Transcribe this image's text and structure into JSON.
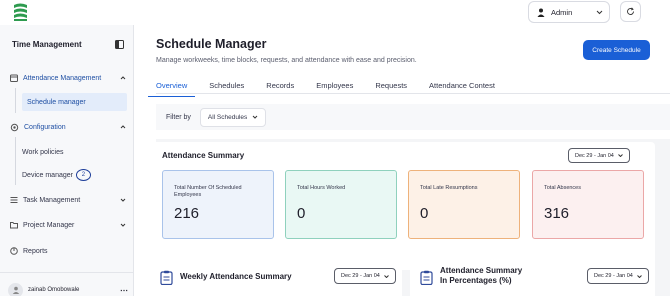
{
  "topbar": {
    "admin_label": "Admin"
  },
  "sidebar": {
    "title": "Time Management",
    "items": [
      {
        "label": "Attendance Management"
      },
      {
        "label": "Schedule manager"
      },
      {
        "label": "Configuration"
      },
      {
        "label": "Work policies"
      },
      {
        "label": "Device manager",
        "badge": "2"
      },
      {
        "label": "Task Management"
      },
      {
        "label": "Project Manager"
      },
      {
        "label": "Reports"
      }
    ],
    "user": {
      "name": "zainab Omobowale"
    }
  },
  "header": {
    "title": "Schedule Manager",
    "subtitle": "Manage workweeks, time blocks, requests, and attendance with ease and precision.",
    "create_button": "Create Schedule"
  },
  "tabs": [
    {
      "label": "Overview",
      "active": true
    },
    {
      "label": "Schedules"
    },
    {
      "label": "Records"
    },
    {
      "label": "Employees"
    },
    {
      "label": "Requests"
    },
    {
      "label": "Attendance Contest"
    }
  ],
  "filter": {
    "label": "Filter by",
    "value": "All Schedules"
  },
  "attendance_summary": {
    "title": "Attendance Summary",
    "date_range": "Dec 29 - Jan 04",
    "cards": [
      {
        "label": "Total Number Of Scheduled Employees",
        "value": "216",
        "color": "#eef3fb",
        "border": "#a9c3ea"
      },
      {
        "label": "Total Hours Worked",
        "value": "0",
        "color": "#e9f8f4",
        "border": "#8fd1bd"
      },
      {
        "label": "Total Late Resumptions",
        "value": "0",
        "color": "#fdf1e7",
        "border": "#eeb27b"
      },
      {
        "label": "Total Absences",
        "value": "316",
        "color": "#fcf0f0",
        "border": "#eba7a7"
      }
    ]
  },
  "weekly_summary": {
    "title": "Weekly Attendance Summary",
    "date_range": "Dec 29 - Jan 04"
  },
  "percent_summary": {
    "title_line1": "Attendance Summary",
    "title_line2": "In Percentages (%)",
    "date_range": "Dec 29 - Jan 04"
  },
  "colors": {
    "accent": "#1a5fd6",
    "brand_green": "#2e9b4f"
  }
}
